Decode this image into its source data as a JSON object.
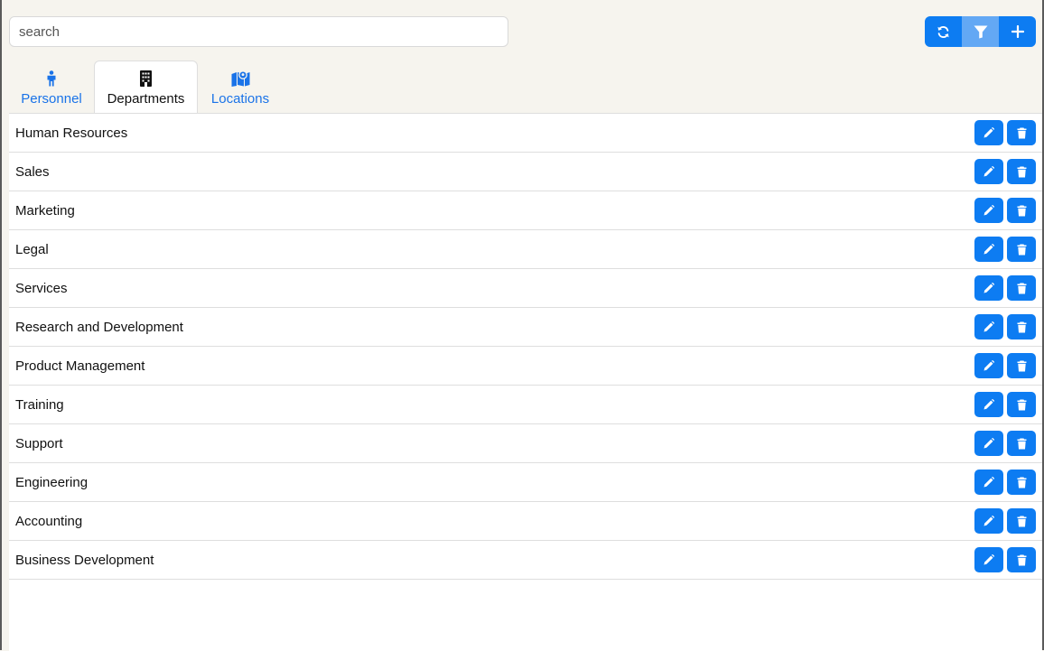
{
  "search": {
    "placeholder": "search",
    "value": ""
  },
  "toolbar": {
    "buttons": [
      {
        "name": "refresh-button",
        "icon": "refresh-icon"
      },
      {
        "name": "filter-button",
        "icon": "filter-icon",
        "active": true
      },
      {
        "name": "add-button",
        "icon": "plus-icon"
      }
    ]
  },
  "tabs": [
    {
      "label": "Personnel",
      "icon": "person-icon",
      "active": false
    },
    {
      "label": "Departments",
      "icon": "building-icon",
      "active": true
    },
    {
      "label": "Locations",
      "icon": "map-icon",
      "active": false
    }
  ],
  "departments": [
    "Human Resources",
    "Sales",
    "Marketing",
    "Legal",
    "Services",
    "Research and Development",
    "Product Management",
    "Training",
    "Support",
    "Engineering",
    "Accounting",
    "Business Development"
  ],
  "row_actions": {
    "edit_icon": "pencil-icon",
    "delete_icon": "trash-icon"
  },
  "colors": {
    "primary": "#0d7cf2",
    "primary_active": "#63a8f4",
    "header_bg": "#f6f4ee",
    "tab_link": "#1a73e8"
  }
}
